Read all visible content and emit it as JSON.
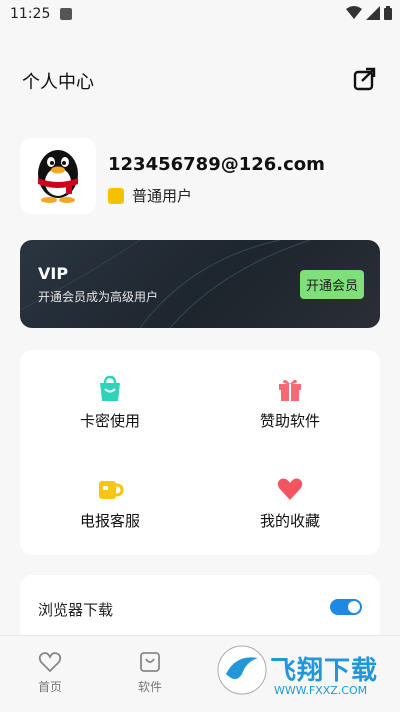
{
  "status": {
    "time": "11:25"
  },
  "header": {
    "title": "个人中心"
  },
  "profile": {
    "email": "123456789@126.com",
    "role": "普通用户"
  },
  "vip": {
    "title": "VIP",
    "subtitle": "开通会员成为高级用户",
    "button": "开通会员"
  },
  "grid": {
    "items": [
      {
        "label": "卡密使用",
        "icon": "bag-icon"
      },
      {
        "label": "赞助软件",
        "icon": "gift-icon"
      },
      {
        "label": "电报客服",
        "icon": "cup-icon"
      },
      {
        "label": "我的收藏",
        "icon": "heart-icon"
      }
    ]
  },
  "settings": {
    "browser_download_label": "浏览器下载",
    "browser_download_on": true
  },
  "tabbar": {
    "tabs": [
      {
        "label": "首页",
        "icon": "heart-outline-icon"
      },
      {
        "label": "软件",
        "icon": "bag-outline-icon"
      }
    ]
  },
  "watermark": {
    "text": "飞翔下载",
    "url": "WWW.FXXZ.COM"
  },
  "colors": {
    "vip_button": "#7fe07a",
    "toggle": "#1e88e5",
    "accent": "#2196d9"
  }
}
